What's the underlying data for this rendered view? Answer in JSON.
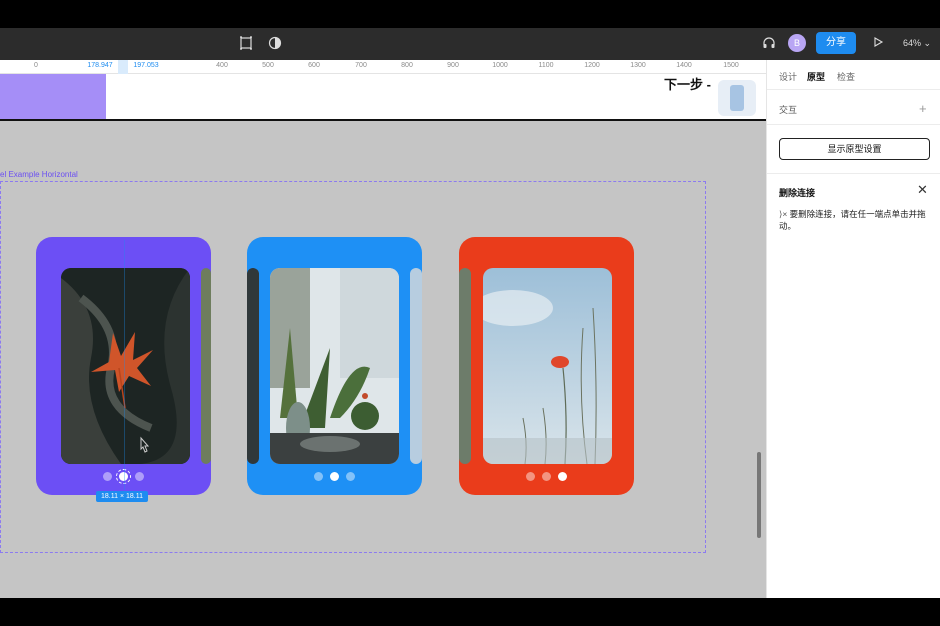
{
  "toolbar": {
    "avatar_letter": "B",
    "share_label": "分享",
    "zoom_label": "64%",
    "icons": [
      "frame-icon",
      "contrast-icon",
      "headphones-icon",
      "play-icon",
      "chevron-down-icon"
    ]
  },
  "ruler": {
    "ticks": [
      "0",
      "178.947",
      "197.053",
      "400",
      "500",
      "600",
      "700",
      "800",
      "900",
      "1000",
      "1100",
      "1200",
      "1300",
      "1400",
      "1500"
    ]
  },
  "canvas": {
    "next_label": "下一步 -",
    "frame_label": "el Example Horizontal",
    "size_badge": "18.11 × 18.11",
    "cards": [
      {
        "color": "#6c4ff5",
        "active_dot": 1
      },
      {
        "color": "#1e90f5",
        "active_dot": 1
      },
      {
        "color": "#ea3c1b",
        "active_dot": 2
      }
    ]
  },
  "panel": {
    "tabs": [
      "设计",
      "原型",
      "检查"
    ],
    "active_tab": "原型",
    "interaction_title": "交互",
    "proto_settings_button": "显示原型设置",
    "delete_title": "删除连接",
    "delete_hint": "要删除连接，请在任一端点单击并拖动。"
  },
  "colors": {
    "accent": "#1e8cf0",
    "canvas_bg": "#c5c5c5",
    "frame_outline": "#8c7af0"
  }
}
